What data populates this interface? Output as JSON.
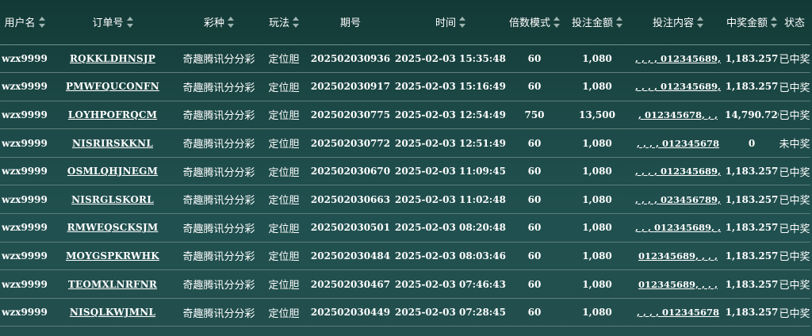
{
  "columns": [
    {
      "key": "user",
      "label": "用户名",
      "sortable": true,
      "icon": "sort-icon"
    },
    {
      "key": "order",
      "label": "订单号",
      "sortable": true,
      "icon": "sort-icon"
    },
    {
      "key": "lottery",
      "label": "彩种",
      "sortable": true,
      "icon": "sort-icon"
    },
    {
      "key": "play",
      "label": "玩法",
      "sortable": true,
      "icon": "sort-icon"
    },
    {
      "key": "issue",
      "label": "期号",
      "sortable": false
    },
    {
      "key": "time",
      "label": "时间",
      "sortable": true,
      "icon": "sort-icon"
    },
    {
      "key": "multiplier",
      "label": "倍数模式",
      "sortable": true,
      "icon": "sort-icon"
    },
    {
      "key": "amount",
      "label": "投注金额",
      "sortable": true,
      "icon": "sort-icon"
    },
    {
      "key": "content",
      "label": "投注内容",
      "sortable": true,
      "icon": "sort-icon"
    },
    {
      "key": "win",
      "label": "中奖金额",
      "sortable": true,
      "icon": "sort-icon"
    },
    {
      "key": "status",
      "label": "状态",
      "sortable": false
    }
  ],
  "rows": [
    {
      "user": "wzx9999",
      "order": "RQKKLDHNSJP",
      "lottery": "奇趣腾讯分分彩",
      "play": "定位胆",
      "issue": "202502030936",
      "time": "2025-02-03 15:35:48",
      "multiplier": "60",
      "amount": "1,080",
      "content": ", , , , 012345689,",
      "win": "1,183.257",
      "status": "已中奖"
    },
    {
      "user": "wzx9999",
      "order": "PMWFQUCONFN",
      "lottery": "奇趣腾讯分分彩",
      "play": "定位胆",
      "issue": "202502030917",
      "time": "2025-02-03 15:16:49",
      "multiplier": "60",
      "amount": "1,080",
      "content": ", , , , 012345689,",
      "win": "1,183.257",
      "status": "已中奖"
    },
    {
      "user": "wzx9999",
      "order": "LOYHPOFRQCM",
      "lottery": "奇趣腾讯分分彩",
      "play": "定位胆",
      "issue": "202502030775",
      "time": "2025-02-03 12:54:49",
      "multiplier": "750",
      "amount": "13,500",
      "content": ", 012345678, , ,",
      "win": "14,790.720",
      "status": "已中奖"
    },
    {
      "user": "wzx9999",
      "order": "NISRIRSKKNL",
      "lottery": "奇趣腾讯分分彩",
      "play": "定位胆",
      "issue": "202502030772",
      "time": "2025-02-03 12:51:49",
      "multiplier": "60",
      "amount": "1,080",
      "content": ", , , , 012345678",
      "win": "0",
      "status": "未中奖"
    },
    {
      "user": "wzx9999",
      "order": "OSMLQHJNEGM",
      "lottery": "奇趣腾讯分分彩",
      "play": "定位胆",
      "issue": "202502030670",
      "time": "2025-02-03 11:09:45",
      "multiplier": "60",
      "amount": "1,080",
      "content": ", , , , 012345689,",
      "win": "1,183.257",
      "status": "已中奖"
    },
    {
      "user": "wzx9999",
      "order": "NISRGLSKORL",
      "lottery": "奇趣腾讯分分彩",
      "play": "定位胆",
      "issue": "202502030663",
      "time": "2025-02-03 11:02:48",
      "multiplier": "60",
      "amount": "1,080",
      "content": ", , , , 023456789,",
      "win": "1,183.257",
      "status": "已中奖"
    },
    {
      "user": "wzx9999",
      "order": "RMWEQSCKSJM",
      "lottery": "奇趣腾讯分分彩",
      "play": "定位胆",
      "issue": "202502030501",
      "time": "2025-02-03 08:20:48",
      "multiplier": "60",
      "amount": "1,080",
      "content": ", , , 012345689, ,",
      "win": "1,183.257",
      "status": "已中奖"
    },
    {
      "user": "wzx9999",
      "order": "MOYGSPKRWHK",
      "lottery": "奇趣腾讯分分彩",
      "play": "定位胆",
      "issue": "202502030484",
      "time": "2025-02-03 08:03:46",
      "multiplier": "60",
      "amount": "1,080",
      "content": "012345689, , , ,",
      "win": "1,183.257",
      "status": "已中奖"
    },
    {
      "user": "wzx9999",
      "order": "TEOMXLNRFNR",
      "lottery": "奇趣腾讯分分彩",
      "play": "定位胆",
      "issue": "202502030467",
      "time": "2025-02-03 07:46:43",
      "multiplier": "60",
      "amount": "1,080",
      "content": "012345689, , , ,",
      "win": "1,183.257",
      "status": "已中奖"
    },
    {
      "user": "wzx9999",
      "order": "NISQLKWJMNL",
      "lottery": "奇趣腾讯分分彩",
      "play": "定位胆",
      "issue": "202502030449",
      "time": "2025-02-03 07:28:45",
      "multiplier": "60",
      "amount": "1,080",
      "content": ", , , , 012345678",
      "win": "1,183.257",
      "status": "已中奖"
    }
  ]
}
